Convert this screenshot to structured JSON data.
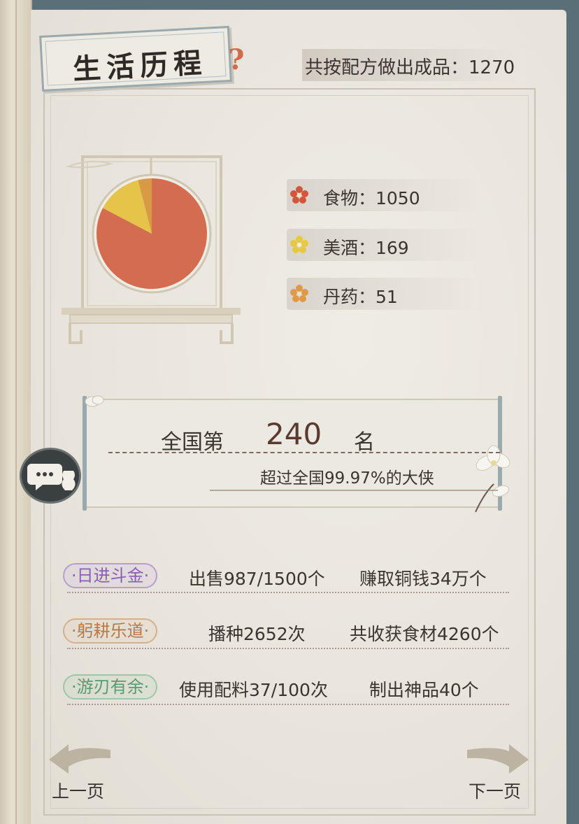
{
  "title": "生活历程",
  "help_icon": "question-mark-icon",
  "total": "共按配方做出成品：1270",
  "chart_data": {
    "type": "pie",
    "categories": [
      "食物",
      "美酒",
      "丹药"
    ],
    "values": [
      1050,
      169,
      51
    ],
    "colors": [
      "#d46c50",
      "#e6c44a",
      "#d89a45"
    ]
  },
  "legend": [
    {
      "label": "食物：1050",
      "icon": "flower-icon",
      "color": "#d4553c"
    },
    {
      "label": "美酒：169",
      "icon": "flower-icon",
      "color": "#e6c844"
    },
    {
      "label": "丹药：51",
      "icon": "flower-icon",
      "color": "#e09a46"
    }
  ],
  "rank": {
    "prefix": "全国第",
    "number": "240",
    "suffix": "名",
    "detail": "超过全国99.97%的大侠"
  },
  "activities": [
    {
      "tag": "·日进斗金·",
      "tag_color": "#8a5fb0",
      "stat1": "出售987/1500个",
      "stat2": "赚取铜钱34万个"
    },
    {
      "tag": "·躬耕乐道·",
      "tag_color": "#b7794a",
      "stat1": "播种2652次",
      "stat2": "共收获食材4260个"
    },
    {
      "tag": "·游刃有余·",
      "tag_color": "#5a9a6e",
      "stat1": "使用配料37/100次",
      "stat2": "制出神品40个"
    }
  ],
  "nav": {
    "prev": "上一页",
    "next": "下一页"
  }
}
